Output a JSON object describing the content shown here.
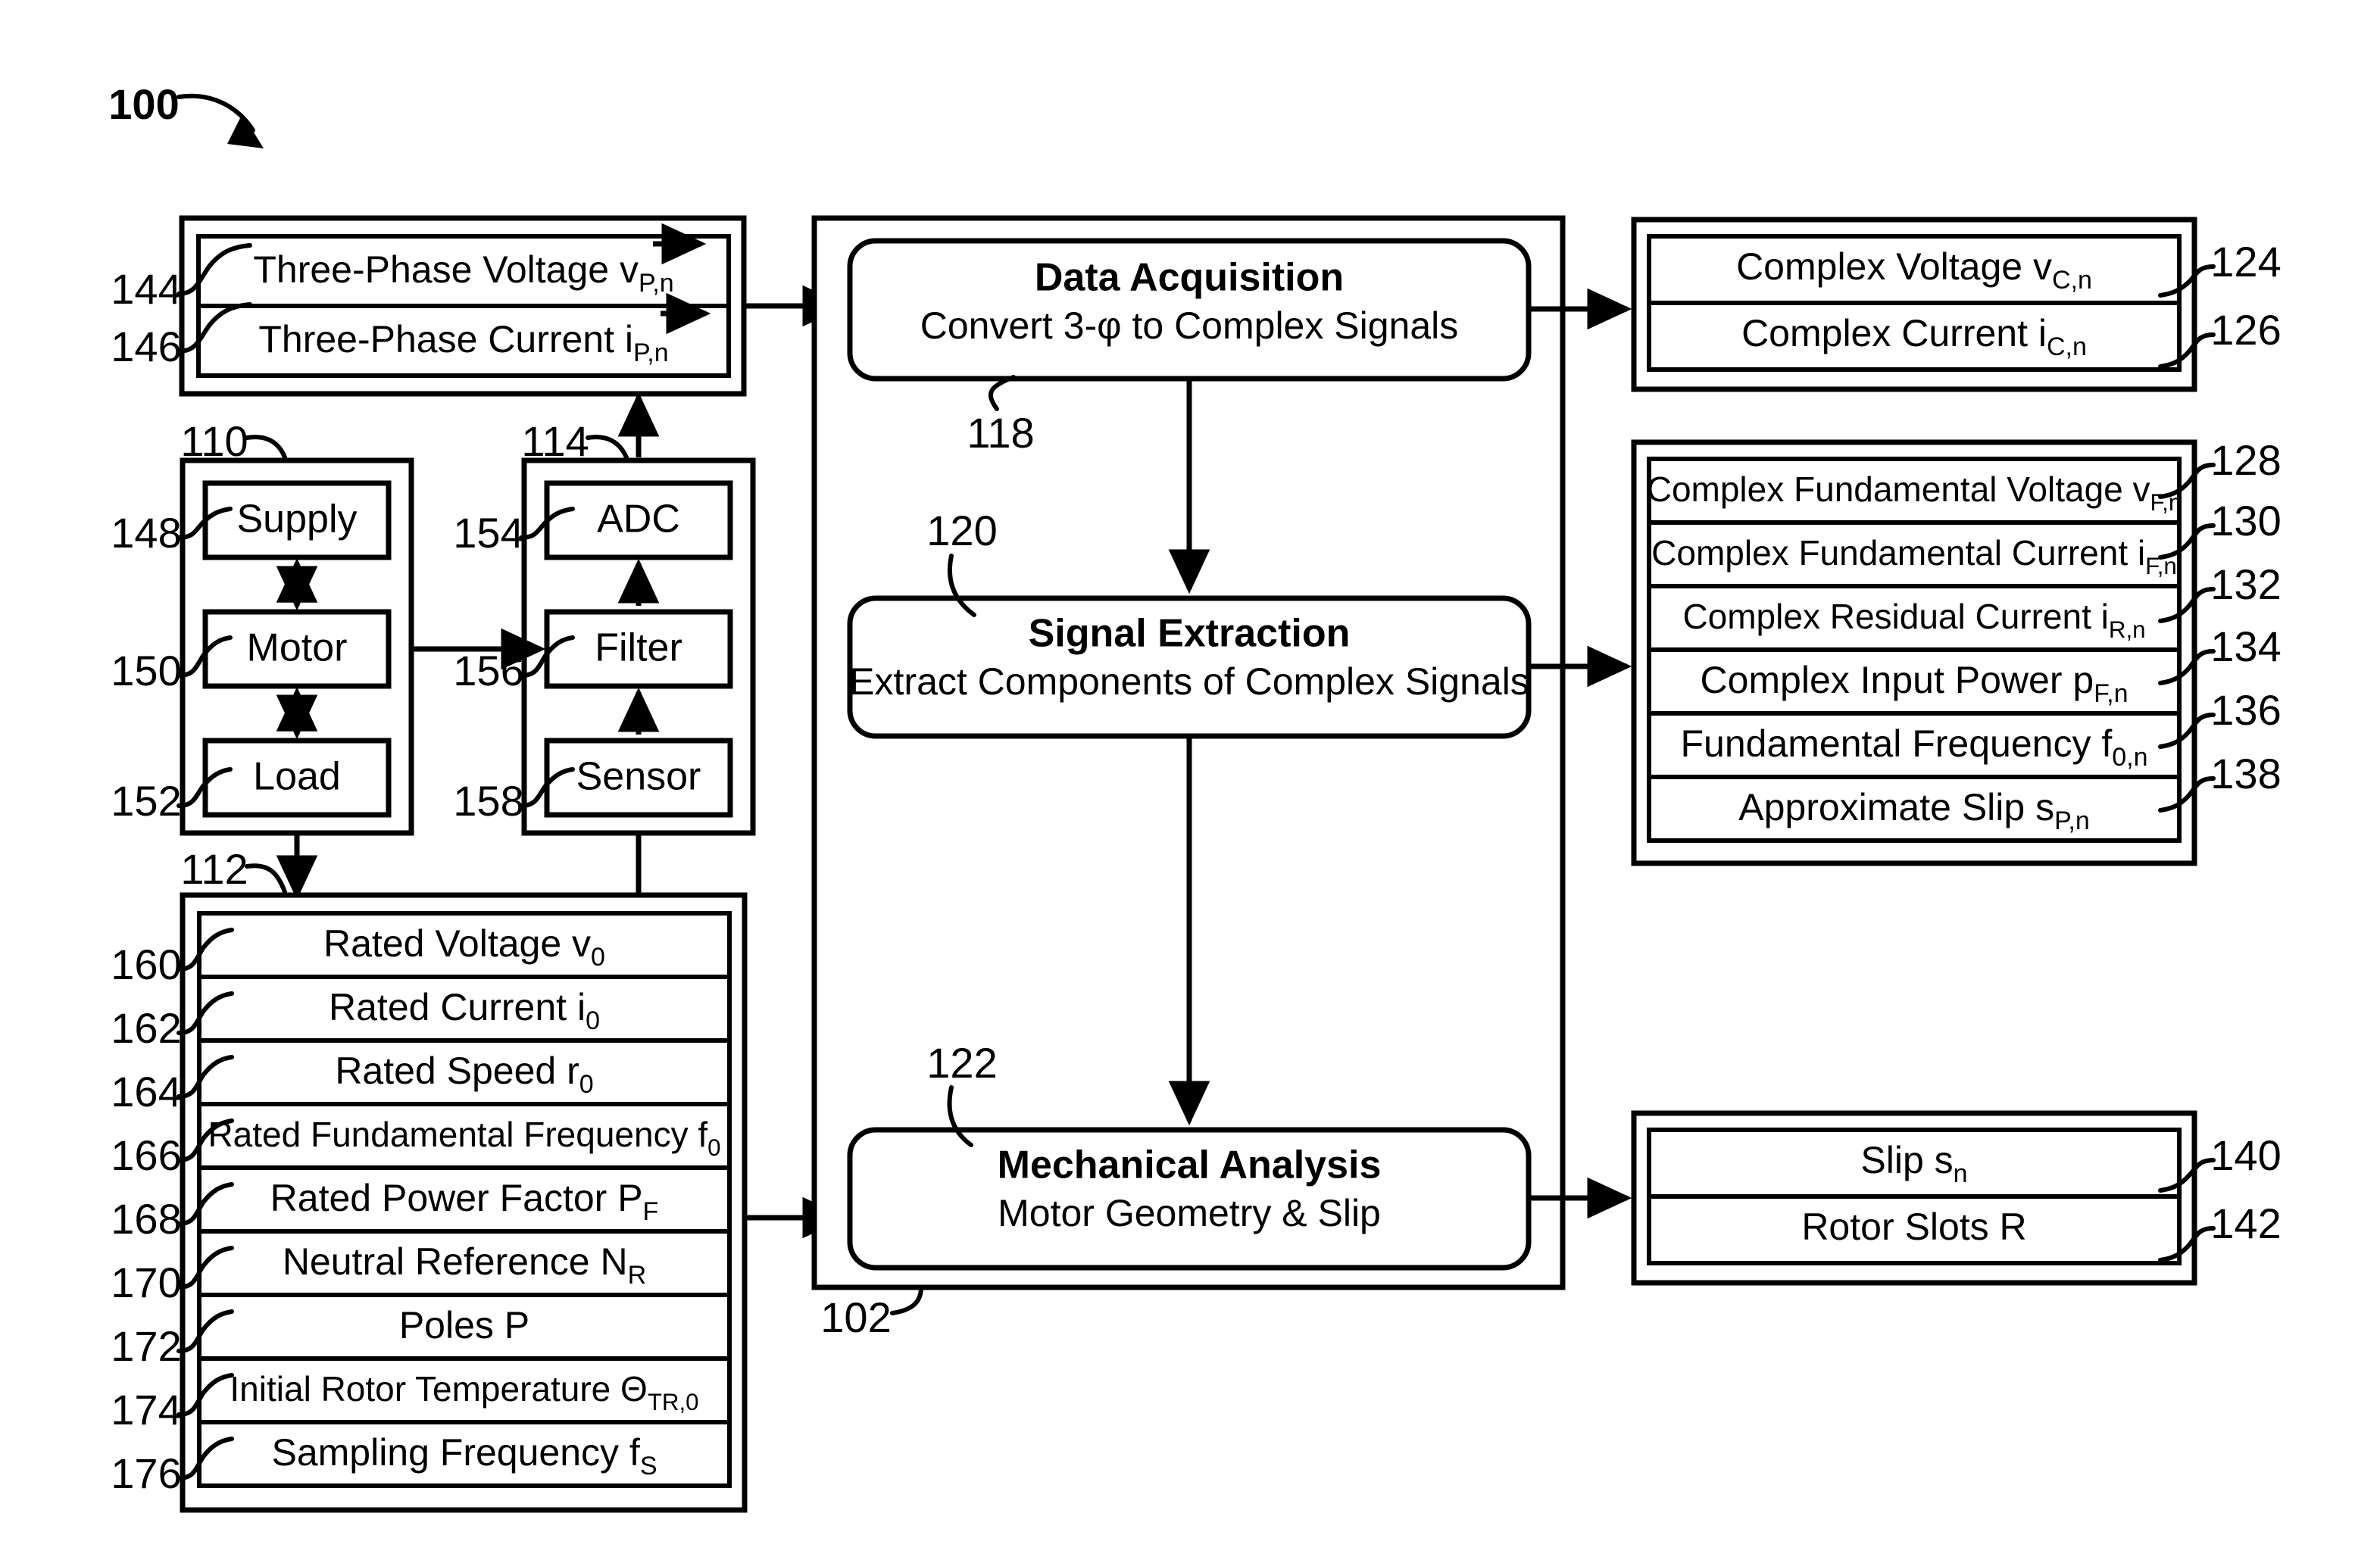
{
  "figure": {
    "number": "100",
    "system_ref": "102"
  },
  "inputs_top": {
    "rows": [
      {
        "ref": "144",
        "text": "Three-Phase Voltage v",
        "sub": "P,n",
        "base": "v",
        "overbar": true
      },
      {
        "ref": "146",
        "text": "Three-Phase Current i",
        "sub": "P,n",
        "base": "i",
        "overbar": true
      }
    ]
  },
  "motor_group": {
    "ref": "110",
    "items": [
      {
        "ref": "148",
        "label": "Supply"
      },
      {
        "ref": "150",
        "label": "Motor"
      },
      {
        "ref": "152",
        "label": "Load"
      }
    ]
  },
  "acquisition_group": {
    "ref": "114",
    "items": [
      {
        "ref": "154",
        "label": "ADC"
      },
      {
        "ref": "156",
        "label": "Filter"
      },
      {
        "ref": "158",
        "label": "Sensor"
      }
    ]
  },
  "rated_params": {
    "ref": "112",
    "rows": [
      {
        "ref": "160",
        "base": "Rated Voltage v",
        "sub": "0"
      },
      {
        "ref": "162",
        "base": "Rated Current i",
        "sub": "0"
      },
      {
        "ref": "164",
        "base": "Rated Speed r",
        "sub": "0"
      },
      {
        "ref": "166",
        "base": "Rated Fundamental Frequency f",
        "sub": "0"
      },
      {
        "ref": "168",
        "base": "Rated Power Factor P",
        "sub": "F"
      },
      {
        "ref": "170",
        "base": "Neutral Reference N",
        "sub": "R"
      },
      {
        "ref": "172",
        "base": "Poles P",
        "sub": ""
      },
      {
        "ref": "174",
        "base": "Initial Rotor Temperature Θ",
        "sub": "TR,0"
      },
      {
        "ref": "176",
        "base": "Sampling Frequency f",
        "sub": "S"
      }
    ]
  },
  "processing": {
    "blocks": [
      {
        "ref": "118",
        "title": "Data Acquisition",
        "subtitle": "Convert 3-φ to Complex Signals"
      },
      {
        "ref": "120",
        "title": "Signal Extraction",
        "subtitle": "Extract Components of Complex Signals"
      },
      {
        "ref": "122",
        "title": "Mechanical Analysis",
        "subtitle": "Motor Geometry & Slip"
      }
    ]
  },
  "outputs_complex": {
    "rows": [
      {
        "ref": "124",
        "base": "Complex Voltage v",
        "sub": "C,n"
      },
      {
        "ref": "126",
        "base": "Complex Current i",
        "sub": "C,n"
      }
    ]
  },
  "outputs_components": {
    "rows": [
      {
        "ref": "128",
        "base": "Complex Fundamental Voltage v",
        "sub": "F,n"
      },
      {
        "ref": "130",
        "base": "Complex Fundamental Current i",
        "sub": "F,n"
      },
      {
        "ref": "132",
        "base": "Complex Residual Current i",
        "sub": "R,n"
      },
      {
        "ref": "134",
        "base": "Complex Input Power p",
        "sub": "F,n"
      },
      {
        "ref": "136",
        "base": "Fundamental Frequency f",
        "sub": "0,n"
      },
      {
        "ref": "138",
        "base": "Approximate Slip s",
        "sub": "P,n"
      }
    ]
  },
  "outputs_mechanical": {
    "rows": [
      {
        "ref": "140",
        "base": "Slip s",
        "sub": "n"
      },
      {
        "ref": "142",
        "base": "Rotor Slots R",
        "sub": ""
      }
    ]
  },
  "colors": {
    "stroke": "#000000",
    "fill": "#ffffff"
  }
}
